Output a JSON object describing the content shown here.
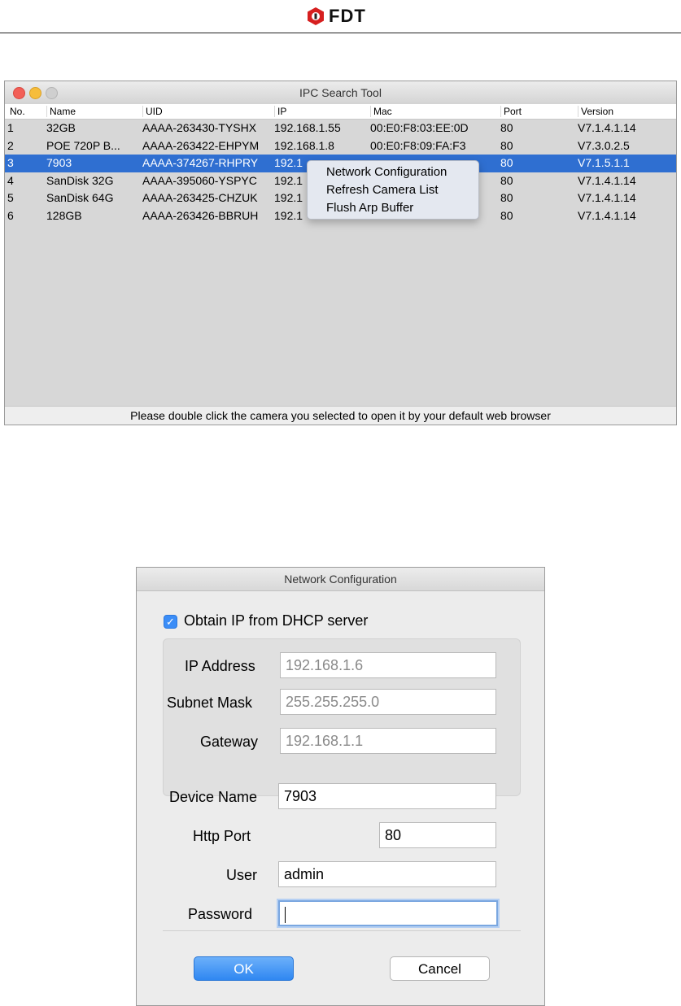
{
  "header": {
    "logo_text": "FDT",
    "logo_color": "#d61f1f"
  },
  "ipc_window": {
    "title": "IPC Search Tool",
    "columns": [
      "No.",
      "Name",
      "UID",
      "IP",
      "Mac",
      "Port",
      "Version"
    ],
    "rows": [
      {
        "no": "1",
        "name": "32GB",
        "uid": "AAAA-263430-TYSHX",
        "ip": "192.168.1.55",
        "mac": "00:E0:F8:03:EE:0D",
        "port": "80",
        "version": "V7.1.4.1.14"
      },
      {
        "no": "2",
        "name": "POE 720P B...",
        "uid": "AAAA-263422-EHPYM",
        "ip": "192.168.1.8",
        "mac": "00:E0:F8:09:FA:F3",
        "port": "80",
        "version": "V7.3.0.2.5"
      },
      {
        "no": "3",
        "name": "7903",
        "uid": "AAAA-374267-RHPRY",
        "ip": "192.1",
        "mac": "",
        "port": "80",
        "version": "V7.1.5.1.1",
        "selected": true
      },
      {
        "no": "4",
        "name": "SanDisk 32G",
        "uid": "AAAA-395060-YSPYC",
        "ip": "192.1",
        "mac": "",
        "port": "80",
        "version": "V7.1.4.1.14"
      },
      {
        "no": "5",
        "name": "SanDisk 64G",
        "uid": "AAAA-263425-CHZUK",
        "ip": "192.1",
        "mac": "",
        "port": "80",
        "version": "V7.1.4.1.14"
      },
      {
        "no": "6",
        "name": "128GB",
        "uid": "AAAA-263426-BBRUH",
        "ip": "192.1",
        "mac": "",
        "port": "80",
        "version": "V7.1.4.1.14"
      }
    ],
    "footer": "Please double click the camera you selected to open it by your default web browser",
    "context_menu": [
      "Network Configuration",
      "Refresh Camera List",
      "Flush Arp Buffer"
    ],
    "selection_color": "#2f6fd1"
  },
  "network_config": {
    "title": "Network Configuration",
    "dhcp_label": "Obtain IP from DHCP server",
    "dhcp_checked": true,
    "ip_label": "IP Address",
    "ip_value": "192.168.1.6",
    "mask_label": "Subnet Mask",
    "mask_value": "255.255.255.0",
    "gateway_label": "Gateway",
    "gateway_value": "192.168.1.1",
    "device_name_label": "Device Name",
    "device_name_value": "7903",
    "http_port_label": "Http Port",
    "http_port_value": "80",
    "user_label": "User",
    "user_value": "admin",
    "password_label": "Password",
    "password_value": "",
    "ok_label": "OK",
    "cancel_label": "Cancel",
    "accent_color": "#3b8df7"
  }
}
